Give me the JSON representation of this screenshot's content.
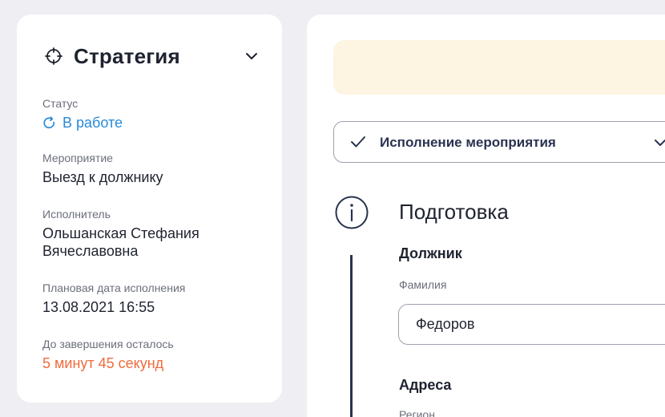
{
  "strategy_card": {
    "title": "Стратегия",
    "fields": [
      {
        "label": "Статус",
        "value": "В работе"
      },
      {
        "label": "Мероприятие",
        "value": "Выезд к должнику"
      },
      {
        "label": "Исполнитель",
        "value_line1": "Ольшанская Стефания",
        "value_line2": "Вячеславовна"
      },
      {
        "label": "Плановая дата исполнения",
        "value": "13.08.2021 16:55"
      },
      {
        "label": "До завершения осталось",
        "value": "5 минут 45 секунд"
      }
    ]
  },
  "main": {
    "stage_dropdown": {
      "label": "Исполнение мероприятия"
    },
    "section_title": "Подготовка",
    "debtor": {
      "title": "Должник",
      "surname_label": "Фамилия",
      "surname_value": "Федоров"
    },
    "addresses": {
      "title": "Адреса",
      "region_label": "Регион"
    }
  },
  "colors": {
    "status_blue": "#2a8ad9",
    "deadline_orange": "#f06b3d",
    "notice_bg": "#fdf4e1",
    "ink": "#1f2330"
  },
  "icons": [
    "target-icon",
    "chevron-down-icon",
    "refresh-icon",
    "check-icon",
    "info-icon"
  ]
}
